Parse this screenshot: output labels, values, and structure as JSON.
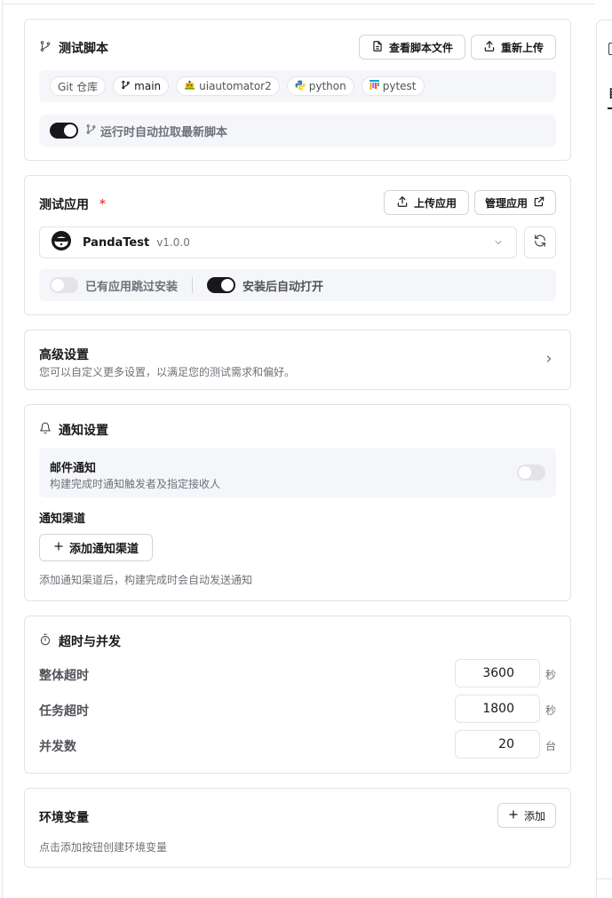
{
  "script_section": {
    "title": "测试脚本",
    "view_button": "查看脚本文件",
    "reupload_button": "重新上传",
    "tags": [
      {
        "label": "Git 仓库",
        "icon": ""
      },
      {
        "label": "main",
        "icon": "git-branch-icon"
      },
      {
        "label": "uiautomator2",
        "icon": "robot-icon"
      },
      {
        "label": "python",
        "icon": "python-icon"
      },
      {
        "label": "pytest",
        "icon": "pytest-icon"
      }
    ],
    "auto_pull_label": "运行时自动拉取最新脚本",
    "auto_pull_on": true
  },
  "app_section": {
    "title": "测试应用",
    "required_mark": "*",
    "upload_button": "上传应用",
    "manage_button": "管理应用",
    "selected_app": {
      "name": "PandaTest",
      "version": "v1.0.0"
    },
    "skip_install_label": "已有应用跳过安装",
    "skip_install_on": false,
    "auto_open_label": "安装后自动打开",
    "auto_open_on": true
  },
  "advanced_section": {
    "title": "高级设置",
    "description": "您可以自定义更多设置，以满足您的测试需求和偏好。"
  },
  "notify_section": {
    "title": "通知设置",
    "email_title": "邮件通知",
    "email_desc": "构建完成时通知触发者及指定接收人",
    "email_on": false,
    "channel_title": "通知渠道",
    "add_channel_button": "添加通知渠道",
    "channel_hint": "添加通知渠道后，构建完成时会自动发送通知"
  },
  "timeout_section": {
    "title": "超时与并发",
    "fields": [
      {
        "label": "整体超时",
        "value": "3600",
        "unit": "秒"
      },
      {
        "label": "任务超时",
        "value": "1800",
        "unit": "秒"
      },
      {
        "label": "并发数",
        "value": "20",
        "unit": "台"
      }
    ]
  },
  "env_section": {
    "title": "环境变量",
    "add_button": "添加",
    "hint": "点击添加按钮创建环境变量"
  },
  "right_pane": {
    "tab_char": "目"
  },
  "colors": {
    "accent": "#18181b",
    "required": "#ef4444",
    "muted": "#71717a",
    "bar_bg": "#f4f6fa"
  }
}
